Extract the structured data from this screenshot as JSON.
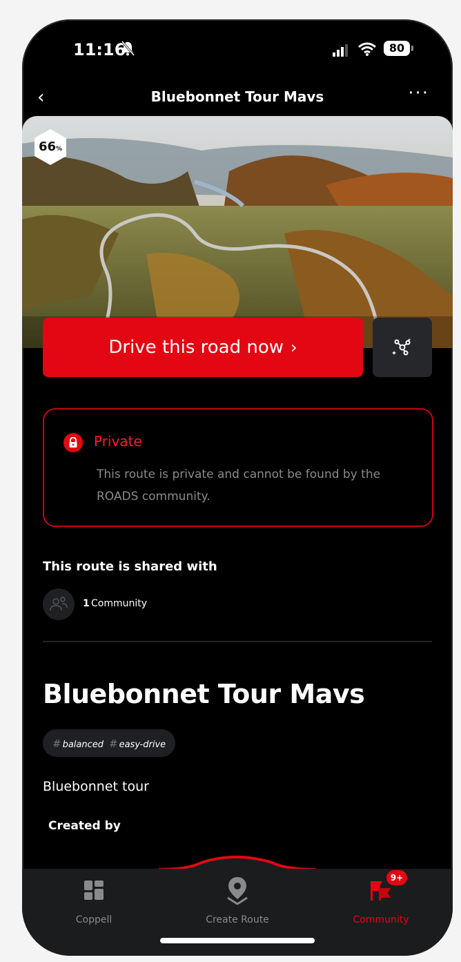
{
  "status_bar": {
    "time": "11:16",
    "battery": "80"
  },
  "nav": {
    "back_icon": "chevron-left-icon",
    "title": "Bluebonnet Tour Mavs",
    "more_icon": "more-dots-icon"
  },
  "hero": {
    "score_value": "66",
    "score_unit": "%"
  },
  "actions": {
    "drive_label": "Drive this road now",
    "drive_arrow": "›",
    "share_icon": "route-share-icon"
  },
  "privacy": {
    "title": "Private",
    "description": "This route is private and cannot be found by the ROADS community."
  },
  "sharing": {
    "title": "This route is shared with",
    "count": "1",
    "label": "Community"
  },
  "route": {
    "title": "Bluebonnet Tour Mavs",
    "tags": [
      "balanced",
      "easy-drive"
    ],
    "description": "Bluebonnet tour",
    "created_by_label": "Created by"
  },
  "tabbar": {
    "items": [
      {
        "label": "Coppell",
        "icon": "dashboard-icon"
      },
      {
        "label": "Create Route",
        "icon": "map-pin-icon"
      },
      {
        "label": "Community",
        "icon": "community-flags-icon",
        "badge": "9+"
      }
    ]
  },
  "colors": {
    "accent": "#e30613",
    "background": "#000000",
    "surface": "#1f2023"
  }
}
